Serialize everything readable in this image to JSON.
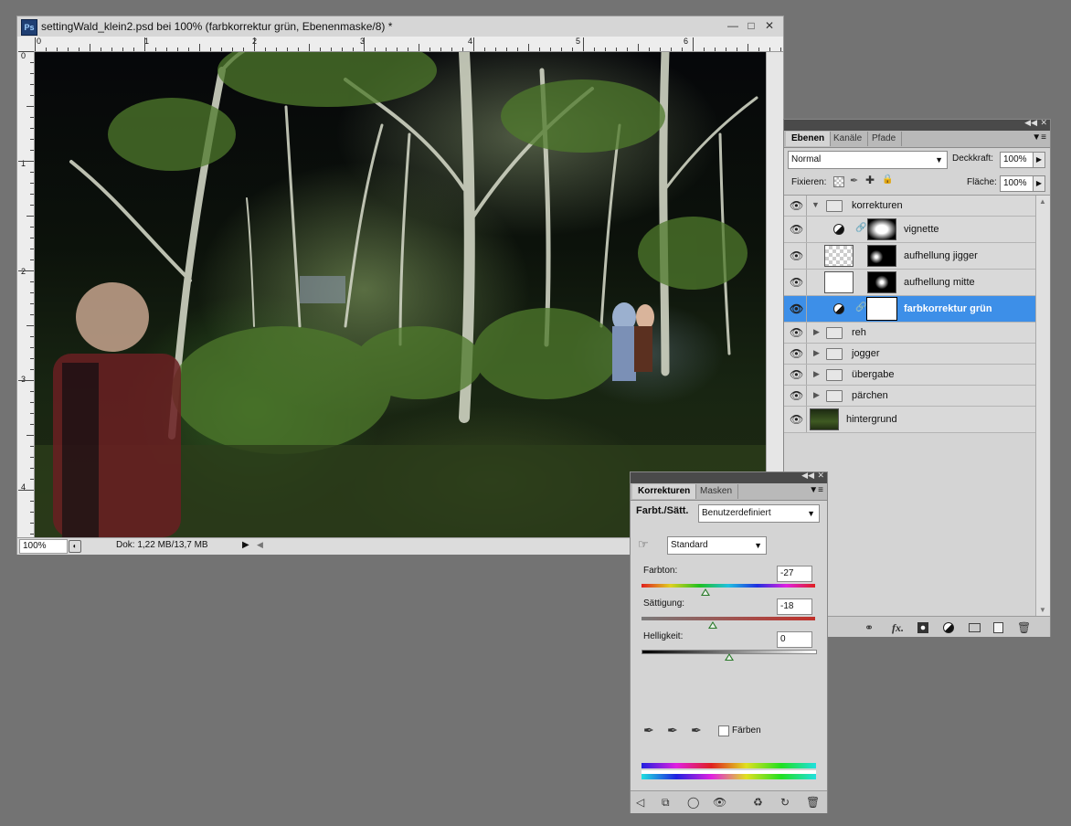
{
  "document": {
    "title": "settingWald_klein2.psd bei 100% (farbkorrektur grün, Ebenenmaske/8) *",
    "app_icon": "Ps",
    "ruler_top_labels": [
      "0",
      "1",
      "2",
      "3",
      "4",
      "5",
      "6"
    ],
    "ruler_left_labels": [
      "0",
      "1",
      "2",
      "3",
      "4"
    ],
    "zoom": "100%",
    "doc_info": "Dok: 1,22 MB/13,7 MB"
  },
  "layers_panel": {
    "tabs": [
      "Ebenen",
      "Kanäle",
      "Pfade"
    ],
    "blend_mode": "Normal",
    "opacity_label": "Deckkraft:",
    "opacity_value": "100%",
    "lock_label": "Fixieren:",
    "fill_label": "Fläche:",
    "fill_value": "100%",
    "layers": [
      {
        "name": "korrekturen",
        "kind": "group-open"
      },
      {
        "name": "vignette",
        "kind": "adjust"
      },
      {
        "name": "aufhellung jigger",
        "kind": "pixel-mask"
      },
      {
        "name": "aufhellung mitte",
        "kind": "pixel-mask"
      },
      {
        "name": "farbkorrektur grün",
        "kind": "adjust",
        "selected": true
      },
      {
        "name": "reh",
        "kind": "group"
      },
      {
        "name": "jogger",
        "kind": "group"
      },
      {
        "name": "übergabe",
        "kind": "group"
      },
      {
        "name": "pärchen",
        "kind": "group"
      },
      {
        "name": "hintergrund",
        "kind": "background"
      }
    ],
    "footer_icons": [
      "link-icon",
      "fx-icon",
      "mask-icon",
      "adjustment-icon",
      "folder-icon",
      "new-layer-icon",
      "trash-icon"
    ],
    "footer_fx": "fx."
  },
  "adjust_panel": {
    "tabs": [
      "Korrekturen",
      "Masken"
    ],
    "type_label": "Farbt./Sätt.",
    "preset": "Benutzerdefiniert",
    "range": "Standard",
    "hue_label": "Farbton:",
    "hue_value": "-27",
    "sat_label": "Sättigung:",
    "sat_value": "-18",
    "light_label": "Helligkeit:",
    "light_value": "0",
    "colorize_label": "Färben",
    "colors": {
      "selected": "#3d8fe8",
      "panel": "#d4d4d4",
      "header": "#4a4a4a"
    }
  }
}
